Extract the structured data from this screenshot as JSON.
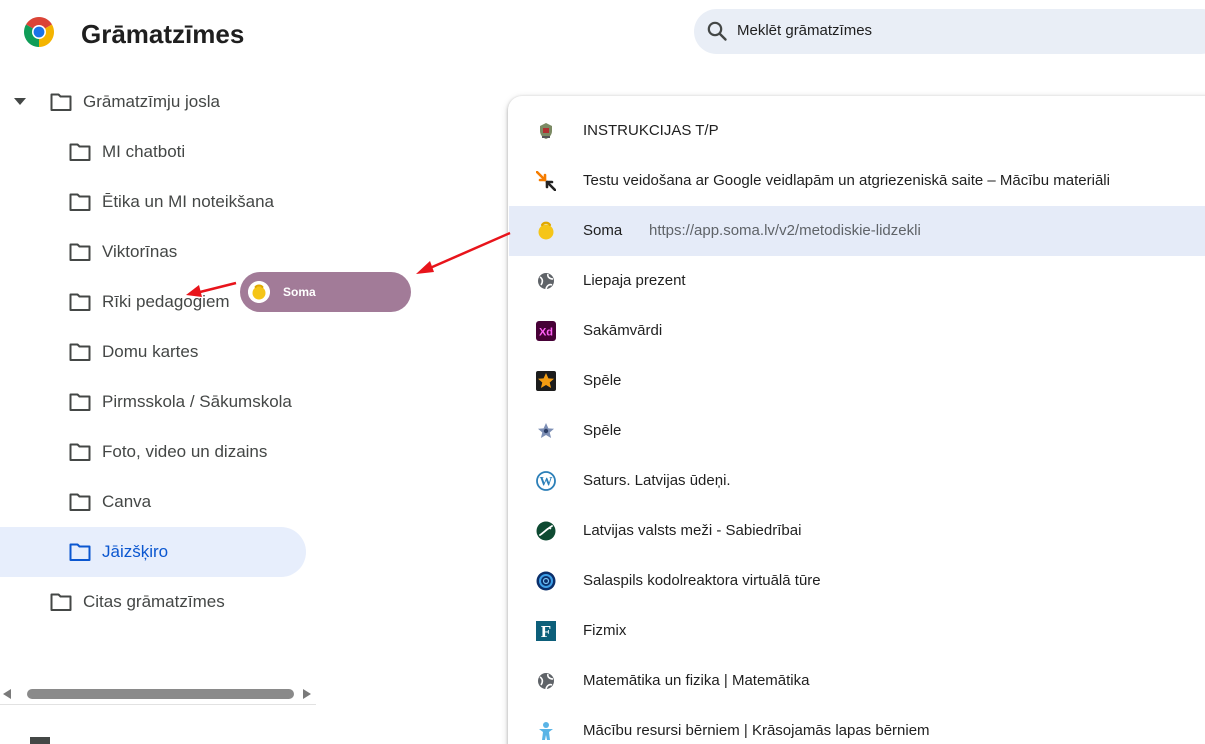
{
  "app": {
    "title": "Grāmatzīmes"
  },
  "search": {
    "placeholder": "Meklēt grāmatzīmes"
  },
  "tree": {
    "root_label": "Grāmatzīmju josla",
    "folders": [
      {
        "label": "MI chatboti",
        "selected": false
      },
      {
        "label": "Ētika un MI noteikšana",
        "selected": false
      },
      {
        "label": "Viktorīnas",
        "selected": false
      },
      {
        "label": "Rīki pedagogiem",
        "selected": false
      },
      {
        "label": "Domu kartes",
        "selected": false
      },
      {
        "label": "Pirmsskola / Sākumskola",
        "selected": false
      },
      {
        "label": "Foto, video un dizains",
        "selected": false
      },
      {
        "label": "Canva",
        "selected": false
      },
      {
        "label": "Jāizšķiro",
        "selected": true
      }
    ],
    "other_label": "Citas grāmatzīmes"
  },
  "drag": {
    "label": "Soma"
  },
  "bookmarks": [
    {
      "title": "INSTRUKCIJAS T/P",
      "url": "",
      "icon": "school-crest-icon"
    },
    {
      "title": "Testu veidošana ar Google veidlapām un atgriezeniskā saite – Mācību materiāli",
      "url": "",
      "icon": "arrows-logo-icon"
    },
    {
      "title": "Soma",
      "url": "https://app.soma.lv/v2/metodiskie-lidzekli",
      "icon": "soma-logo-icon",
      "highlighted": true
    },
    {
      "title": "Liepaja prezent",
      "url": "",
      "icon": "globe-icon"
    },
    {
      "title": "Sakāmvārdi",
      "url": "",
      "icon": "adobe-xd-icon"
    },
    {
      "title": "Spēle",
      "url": "",
      "icon": "star-orange-icon"
    },
    {
      "title": "Spēle",
      "url": "",
      "icon": "star-blue-icon"
    },
    {
      "title": "Saturs. Latvijas ūdeņi.",
      "url": "",
      "icon": "wordpress-icon"
    },
    {
      "title": "Latvijas valsts meži - Sabiedrībai",
      "url": "",
      "icon": "lvm-leaf-icon"
    },
    {
      "title": "Salaspils kodolreaktora virtuālā tūre",
      "url": "",
      "icon": "reactor-logo-icon"
    },
    {
      "title": "Fizmix",
      "url": "",
      "icon": "fizmix-logo-icon"
    },
    {
      "title": "Matemātika un fizika | Matemātika",
      "url": "",
      "icon": "globe-icon"
    },
    {
      "title": "Mācību resursi bērniem | Krāsojamās lapas bērniem",
      "url": "",
      "icon": "child-figure-icon"
    }
  ],
  "colors": {
    "selected": "#0b57d0",
    "drag_pill": "#a27b98",
    "highlight_row": "#e5ebf8",
    "annotation_arrow": "#e8141b"
  }
}
